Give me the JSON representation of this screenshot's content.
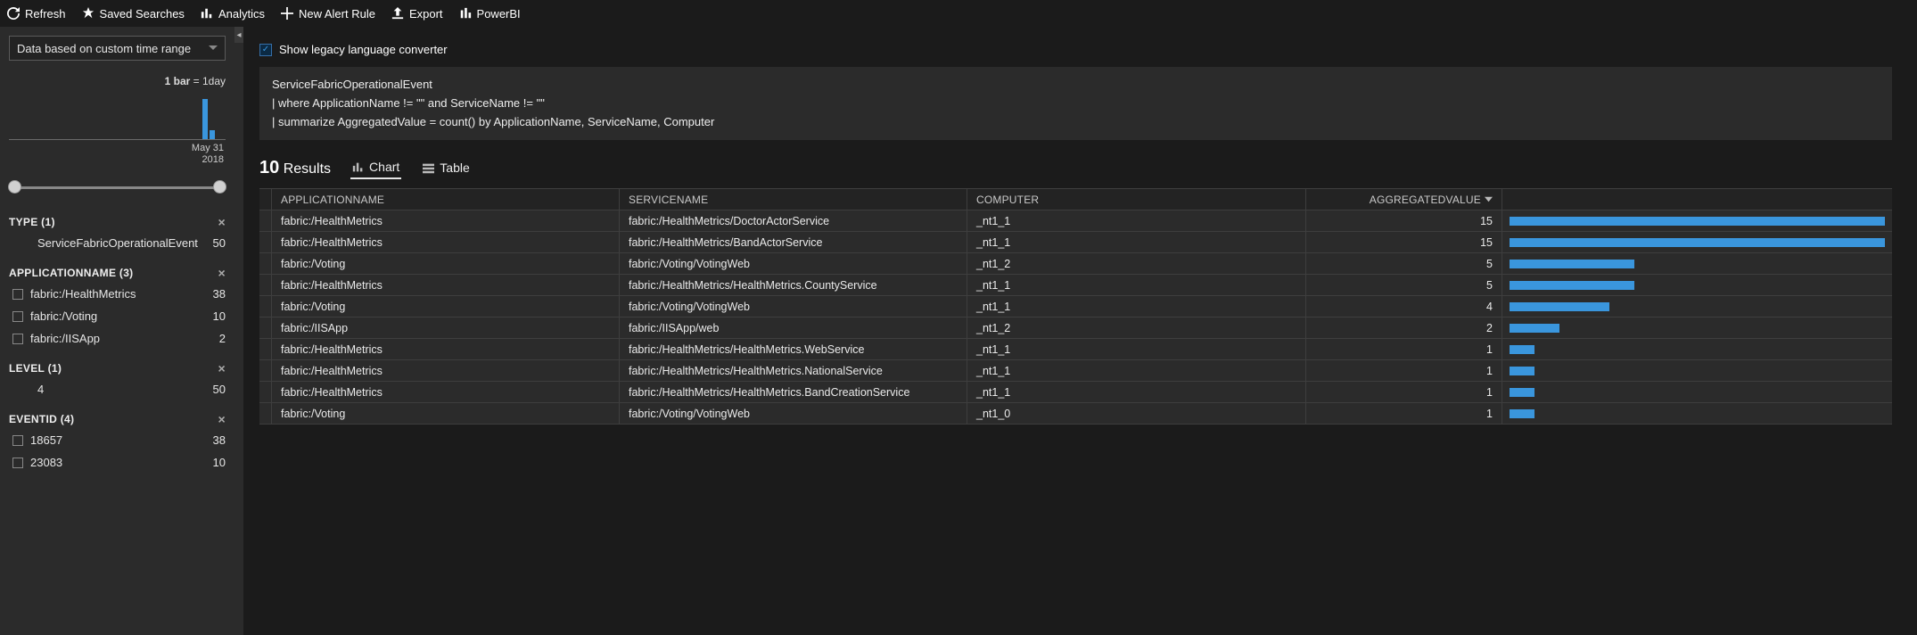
{
  "toolbar": {
    "refresh": "Refresh",
    "saved_searches": "Saved Searches",
    "analytics": "Analytics",
    "new_alert_rule": "New Alert Rule",
    "export": "Export",
    "powerbi": "PowerBI"
  },
  "sidebar": {
    "time_range_label": "Data based on custom time range",
    "bar_legend_bold": "1 bar",
    "bar_legend_rest": " = 1day",
    "mini_date_line1": "May 31",
    "mini_date_line2": "2018",
    "facets": [
      {
        "title": "TYPE  (1)",
        "items": [
          {
            "label": "ServiceFabricOperationalEvent",
            "count": "50",
            "checkbox": false
          }
        ]
      },
      {
        "title": "APPLICATIONNAME  (3)",
        "items": [
          {
            "label": "fabric:/HealthMetrics",
            "count": "38",
            "checkbox": true
          },
          {
            "label": "fabric:/Voting",
            "count": "10",
            "checkbox": true
          },
          {
            "label": "fabric:/IISApp",
            "count": "2",
            "checkbox": true
          }
        ]
      },
      {
        "title": "LEVEL  (1)",
        "items": [
          {
            "label": "4",
            "count": "50",
            "checkbox": false
          }
        ]
      },
      {
        "title": "EVENTID  (4)",
        "items": [
          {
            "label": "18657",
            "count": "38",
            "checkbox": true
          },
          {
            "label": "23083",
            "count": "10",
            "checkbox": true
          }
        ]
      }
    ]
  },
  "legacy_toggle": "Show legacy language converter",
  "query": {
    "line1": "ServiceFabricOperationalEvent",
    "line2": "| where ApplicationName != \"\" and ServiceName != \"\"",
    "line3": "| summarize AggregatedValue = count() by ApplicationName, ServiceName, Computer"
  },
  "results": {
    "count": "10",
    "count_label": " Results",
    "chart_label": "Chart",
    "table_label": "Table"
  },
  "grid": {
    "headers": {
      "app": "APPLICATIONNAME",
      "svc": "SERVICENAME",
      "comp": "COMPUTER",
      "agg": "AGGREGATEDVALUE"
    },
    "rows": [
      {
        "app": "fabric:/HealthMetrics",
        "svc": "fabric:/HealthMetrics/DoctorActorService",
        "comp": "_nt1_1",
        "agg": "15"
      },
      {
        "app": "fabric:/HealthMetrics",
        "svc": "fabric:/HealthMetrics/BandActorService",
        "comp": "_nt1_1",
        "agg": "15"
      },
      {
        "app": "fabric:/Voting",
        "svc": "fabric:/Voting/VotingWeb",
        "comp": "_nt1_2",
        "agg": "5"
      },
      {
        "app": "fabric:/HealthMetrics",
        "svc": "fabric:/HealthMetrics/HealthMetrics.CountyService",
        "comp": "_nt1_1",
        "agg": "5"
      },
      {
        "app": "fabric:/Voting",
        "svc": "fabric:/Voting/VotingWeb",
        "comp": "_nt1_1",
        "agg": "4"
      },
      {
        "app": "fabric:/IISApp",
        "svc": "fabric:/IISApp/web",
        "comp": "_nt1_2",
        "agg": "2"
      },
      {
        "app": "fabric:/HealthMetrics",
        "svc": "fabric:/HealthMetrics/HealthMetrics.WebService",
        "comp": "_nt1_1",
        "agg": "1"
      },
      {
        "app": "fabric:/HealthMetrics",
        "svc": "fabric:/HealthMetrics/HealthMetrics.NationalService",
        "comp": "_nt1_1",
        "agg": "1"
      },
      {
        "app": "fabric:/HealthMetrics",
        "svc": "fabric:/HealthMetrics/HealthMetrics.BandCreationService",
        "comp": "_nt1_1",
        "agg": "1"
      },
      {
        "app": "fabric:/Voting",
        "svc": "fabric:/Voting/VotingWeb",
        "comp": "_nt1_0",
        "agg": "1"
      }
    ]
  },
  "chart_data": {
    "type": "bar",
    "orientation": "horizontal",
    "xlabel": "AggregatedValue",
    "series": [
      {
        "app": "fabric:/HealthMetrics",
        "svc": "fabric:/HealthMetrics/DoctorActorService",
        "comp": "_nt1_1",
        "value": 15
      },
      {
        "app": "fabric:/HealthMetrics",
        "svc": "fabric:/HealthMetrics/BandActorService",
        "comp": "_nt1_1",
        "value": 15
      },
      {
        "app": "fabric:/Voting",
        "svc": "fabric:/Voting/VotingWeb",
        "comp": "_nt1_2",
        "value": 5
      },
      {
        "app": "fabric:/HealthMetrics",
        "svc": "fabric:/HealthMetrics/HealthMetrics.CountyService",
        "comp": "_nt1_1",
        "value": 5
      },
      {
        "app": "fabric:/Voting",
        "svc": "fabric:/Voting/VotingWeb",
        "comp": "_nt1_1",
        "value": 4
      },
      {
        "app": "fabric:/IISApp",
        "svc": "fabric:/IISApp/web",
        "comp": "_nt1_2",
        "value": 2
      },
      {
        "app": "fabric:/HealthMetrics",
        "svc": "fabric:/HealthMetrics/HealthMetrics.WebService",
        "comp": "_nt1_1",
        "value": 1
      },
      {
        "app": "fabric:/HealthMetrics",
        "svc": "fabric:/HealthMetrics/HealthMetrics.NationalService",
        "comp": "_nt1_1",
        "value": 1
      },
      {
        "app": "fabric:/HealthMetrics",
        "svc": "fabric:/HealthMetrics/HealthMetrics.BandCreationService",
        "comp": "_nt1_1",
        "value": 1
      },
      {
        "app": "fabric:/Voting",
        "svc": "fabric:/Voting/VotingWeb",
        "comp": "_nt1_0",
        "value": 1
      }
    ],
    "max": 15
  }
}
